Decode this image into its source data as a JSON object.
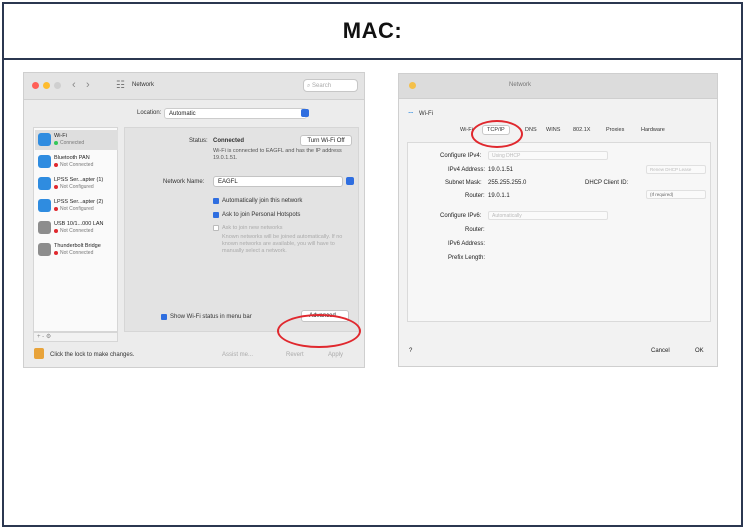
{
  "heading": "MAC:",
  "network_window": {
    "title": "Network",
    "search_placeholder": "Search",
    "location_label": "Location:",
    "location_value": "Automatic",
    "services": [
      {
        "name": "Wi-Fi",
        "status": "Connected",
        "color": "#2f8ce0",
        "dot": "#34c759"
      },
      {
        "name": "Bluetooth PAN",
        "status": "Not Connected",
        "color": "#2f8ce0",
        "dot": "#e0282e"
      },
      {
        "name": "LPSS Ser...apter (1)",
        "status": "Not Configured",
        "color": "#2f8ce0",
        "dot": "#e0282e"
      },
      {
        "name": "LPSS Ser...apter (2)",
        "status": "Not Configured",
        "color": "#2f8ce0",
        "dot": "#e0282e"
      },
      {
        "name": "USB 10/1...000 LAN",
        "status": "Not Connected",
        "color": "#8d8d8d",
        "dot": "#e0282e"
      },
      {
        "name": "Thunderbolt Bridge",
        "status": "Not Connected",
        "color": "#8d8d8d",
        "dot": "#e0282e"
      }
    ],
    "sidebar_footer": "+ - ⚙",
    "status_label": "Status:",
    "status_value": "Connected",
    "turn_off_button": "Turn Wi-Fi Off",
    "status_detail": "Wi-Fi is connected to EAGFL and has the IP address 19.0.1.51.",
    "network_name_label": "Network Name:",
    "network_name_value": "EAGFL",
    "auto_join_label": "Automatically join this network",
    "hotspot_label": "Ask to join Personal Hotspots",
    "ask_new_label": "Ask to join new networks",
    "ask_new_detail": "Known networks will be joined automatically. If no known networks are available, you will have to manually select a network.",
    "show_status_label": "Show Wi-Fi status in menu bar",
    "advanced_button": "Advanced...",
    "lock_text": "Click the lock to make changes.",
    "assist_button": "Assist me...",
    "revert_button": "Revert",
    "apply_button": "Apply"
  },
  "advanced_window": {
    "title": "Network",
    "service_label": "Wi-Fi",
    "tabs": [
      "Wi-Fi",
      "TCP/IP",
      "DNS",
      "WINS",
      "802.1X",
      "Proxies",
      "Hardware"
    ],
    "active_tab": "TCP/IP",
    "configure_ipv4_label": "Configure IPv4:",
    "configure_ipv4_value": "Using DHCP",
    "ipv4_address_label": "IPv4 Address:",
    "ipv4_address_value": "19.0.1.51",
    "subnet_label": "Subnet Mask:",
    "subnet_value": "255.255.255.0",
    "router_label": "Router:",
    "router_value": "19.0.1.1",
    "renew_button": "Renew DHCP Lease",
    "dhcp_client_label": "DHCP Client ID:",
    "dhcp_client_placeholder": "(If required)",
    "configure_ipv6_label": "Configure IPv6:",
    "configure_ipv6_value": "Automatically",
    "router6_label": "Router:",
    "ipv6_address_label": "IPv6 Address:",
    "prefix_label": "Prefix Length:",
    "help_button": "?",
    "cancel_button": "Cancel",
    "ok_button": "OK"
  },
  "colors": {
    "accent": "#2f6ee0",
    "highlight": "#e0282e",
    "frame": "#2b3750"
  }
}
